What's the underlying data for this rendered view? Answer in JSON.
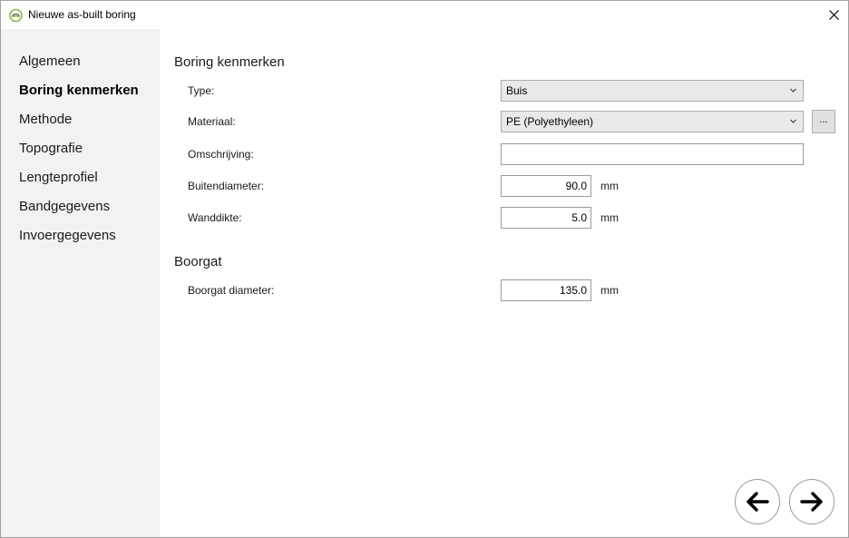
{
  "window": {
    "title": "Nieuwe as-built boring"
  },
  "sidebar": {
    "items": [
      {
        "label": "Algemeen",
        "active": false
      },
      {
        "label": "Boring kenmerken",
        "active": true
      },
      {
        "label": "Methode",
        "active": false
      },
      {
        "label": "Topografie",
        "active": false
      },
      {
        "label": "Lengteprofiel",
        "active": false
      },
      {
        "label": "Bandgegevens",
        "active": false
      },
      {
        "label": "Invoergegevens",
        "active": false
      }
    ]
  },
  "sections": {
    "kenmerken": {
      "title": "Boring kenmerken",
      "type_label": "Type:",
      "type_value": "Buis",
      "materiaal_label": "Materiaal:",
      "materiaal_value": "PE (Polyethyleen)",
      "materiaal_button": "...",
      "omschrijving_label": "Omschrijving:",
      "omschrijving_value": "",
      "buitendiameter_label": "Buitendiameter:",
      "buitendiameter_value": "90.0",
      "buitendiameter_unit": "mm",
      "wanddikte_label": "Wanddikte:",
      "wanddikte_value": "5.0",
      "wanddikte_unit": "mm"
    },
    "boorgat": {
      "title": "Boorgat",
      "diameter_label": "Boorgat diameter:",
      "diameter_value": "135.0",
      "diameter_unit": "mm"
    }
  },
  "icons": {
    "app": "app-logo-icon",
    "close": "close-icon",
    "back": "arrow-left-icon",
    "next": "arrow-right-icon",
    "dropdown": "chevron-down-icon"
  },
  "colors": {
    "sidebar_bg": "#f2f2f2",
    "combo_bg": "#e9e9e9",
    "logo_green": "#8cb83c"
  }
}
